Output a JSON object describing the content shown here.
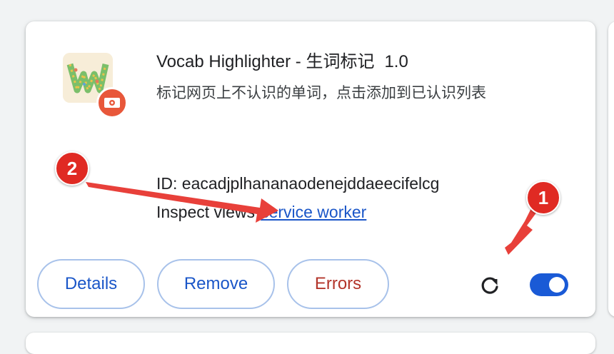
{
  "extension": {
    "name": "Vocab Highlighter - 生词标记",
    "version": "1.0",
    "description": "标记网页上不认识的单词，点击添加到已认识列表",
    "id_line": "ID: eacadjplhananaodenejddaeecifelcg",
    "inspect_label": "Inspect views",
    "inspect_link": "service worker",
    "icon": "vocab-w-logo-icon",
    "badge_icon": "camera-icon"
  },
  "buttons": {
    "details": "Details",
    "remove": "Remove",
    "errors": "Errors"
  },
  "controls": {
    "reload_icon": "reload-icon",
    "enabled": true
  },
  "annotations": {
    "marker_1": "1",
    "marker_2": "2"
  },
  "colors": {
    "accent": "#1a5ad6",
    "link": "#1a56c8",
    "errors_text": "#b3352b",
    "annotation": "#e02a23",
    "badge": "#e8573a"
  }
}
